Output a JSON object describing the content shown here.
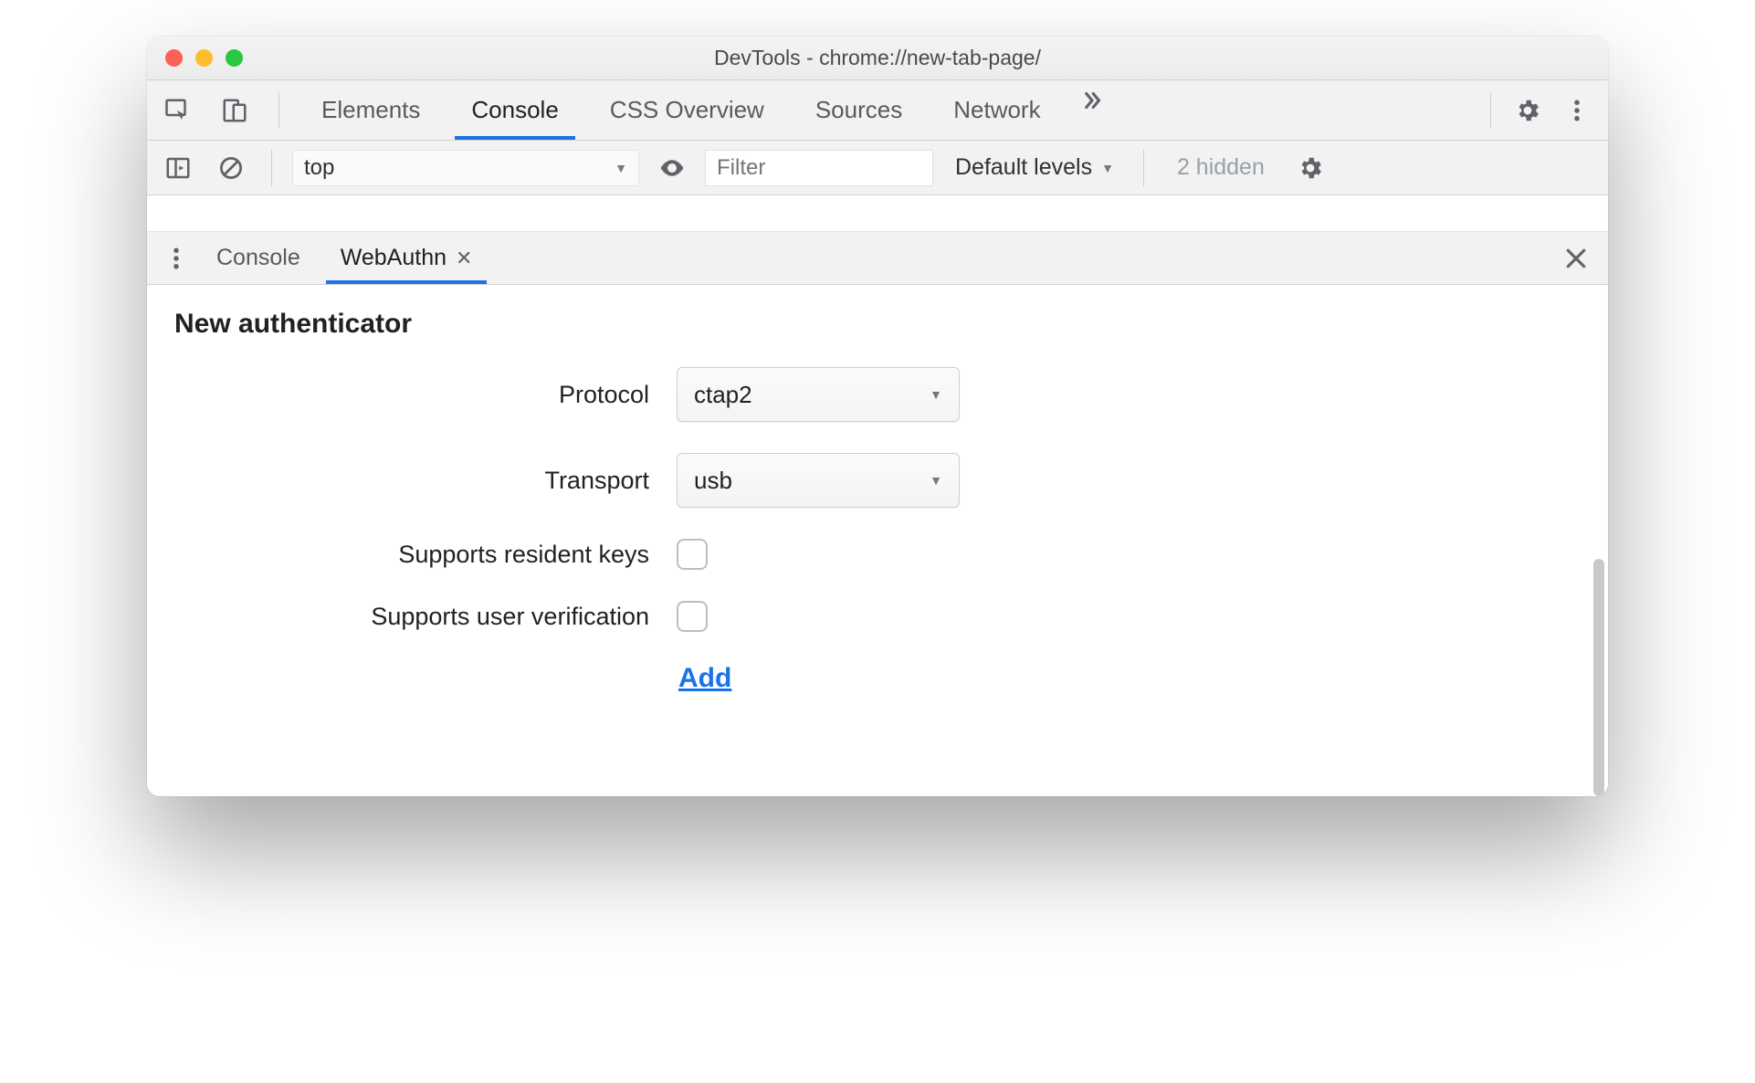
{
  "window_title": "DevTools - chrome://new-tab-page/",
  "main_tabs": {
    "items": [
      "Elements",
      "Console",
      "CSS Overview",
      "Sources",
      "Network"
    ],
    "active_index": 1
  },
  "console_bar": {
    "context": "top",
    "filter_placeholder": "Filter",
    "levels_label": "Default levels",
    "hidden_label": "2 hidden"
  },
  "drawer_tabs": {
    "items": [
      "Console",
      "WebAuthn"
    ],
    "active_index": 1,
    "closable_index": 1
  },
  "panel": {
    "heading": "New authenticator",
    "protocol_label": "Protocol",
    "protocol_value": "ctap2",
    "transport_label": "Transport",
    "transport_value": "usb",
    "resident_keys_label": "Supports resident keys",
    "user_verification_label": "Supports user verification",
    "add_label": "Add"
  }
}
